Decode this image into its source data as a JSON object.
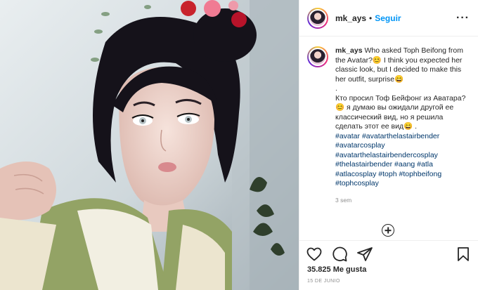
{
  "post": {
    "username": "mk_ays",
    "separator": "•",
    "follow_label": "Seguir",
    "more_label": "···",
    "caption_user": "mk_ays",
    "caption_lines": [
      "Who asked Toph Beifong from the Avatar?😊 I think you expected her classic look, but I decided to make this her outfit, surprise😄",
      ".",
      "Кто просил Тоф Бейфонг из Аватара?😊 я думаю вы ожидали другой ее классический вид, но я решила сделать этот ее вид😄 ."
    ],
    "hashtags": [
      "#avatar #avatarthelastairbender",
      "#avatarcosplay",
      "#avatarthelastairbendercosplay",
      "#thelastairbender #aang #atla",
      "#atlacosplay #toph #tophbeifong",
      "#tophcosplay"
    ],
    "time_ago": "3 sem",
    "likes": "35.825 Me gusta",
    "date": "15 DE JUNIO"
  },
  "icons": {
    "like": "heart-icon",
    "comment": "comment-icon",
    "share": "paper-plane-icon",
    "save": "bookmark-icon",
    "add_comment": "plus-circle-icon",
    "more": "ellipsis-icon"
  },
  "colors": {
    "link": "#0095f6",
    "hashtag": "#00376b",
    "muted": "#8e8e8e",
    "text": "#262626"
  }
}
